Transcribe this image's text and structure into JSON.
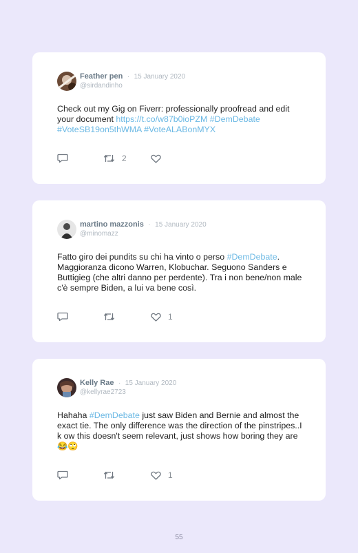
{
  "tweets": [
    {
      "name": "Feather pen",
      "date": "15 January 2020",
      "handle": "@sirdandinho",
      "text_before": "Check out my Gig on Fiverr: professionally proofread and edit your document ",
      "link_1": "https://t.co/w87b0ioPZM",
      "link_2": "#DemDebate",
      "link_3": "#VoteSB19on5thWMA",
      "link_4": "#VoteALABonMYX",
      "reply_count": "",
      "retweet_count": "2",
      "like_count": ""
    },
    {
      "name": "martino mazzonis",
      "date": "15 January 2020",
      "handle": "@minomazz",
      "text_before": "Fatto giro dei pundits su chi ha vinto o perso ",
      "link_1": "#DemDebate",
      "text_after": ". Maggioranza dicono Warren, Klobuchar. Seguono Sanders e Buttigieg (che altri danno per perdente). Tra i non bene/non male c'è sempre Biden, a lui va bene così.",
      "reply_count": "",
      "retweet_count": "",
      "like_count": "1"
    },
    {
      "name": "Kelly Rae",
      "date": "15 January 2020",
      "handle": "@kellyrae2723",
      "text_before": "Hahaha ",
      "link_1": "#DemDebate",
      "text_after": " just saw Biden and Bernie and almost the exact tie. The only difference was the direction of the pinstripes..I k ow this doesn't seem relevant, just shows how boring they are 😂🙄",
      "reply_count": "",
      "retweet_count": "",
      "like_count": "1"
    }
  ],
  "separator": "·",
  "page_number": "55",
  "colors": {
    "background": "#ebe8fb",
    "card": "#ffffff",
    "link": "#6ab8e4",
    "name": "#6b7b88",
    "muted": "#b0b8c0"
  },
  "icons": {
    "reply": "speech-bubble-icon",
    "retweet": "retweet-arrows-icon",
    "like": "heart-outline-icon"
  }
}
